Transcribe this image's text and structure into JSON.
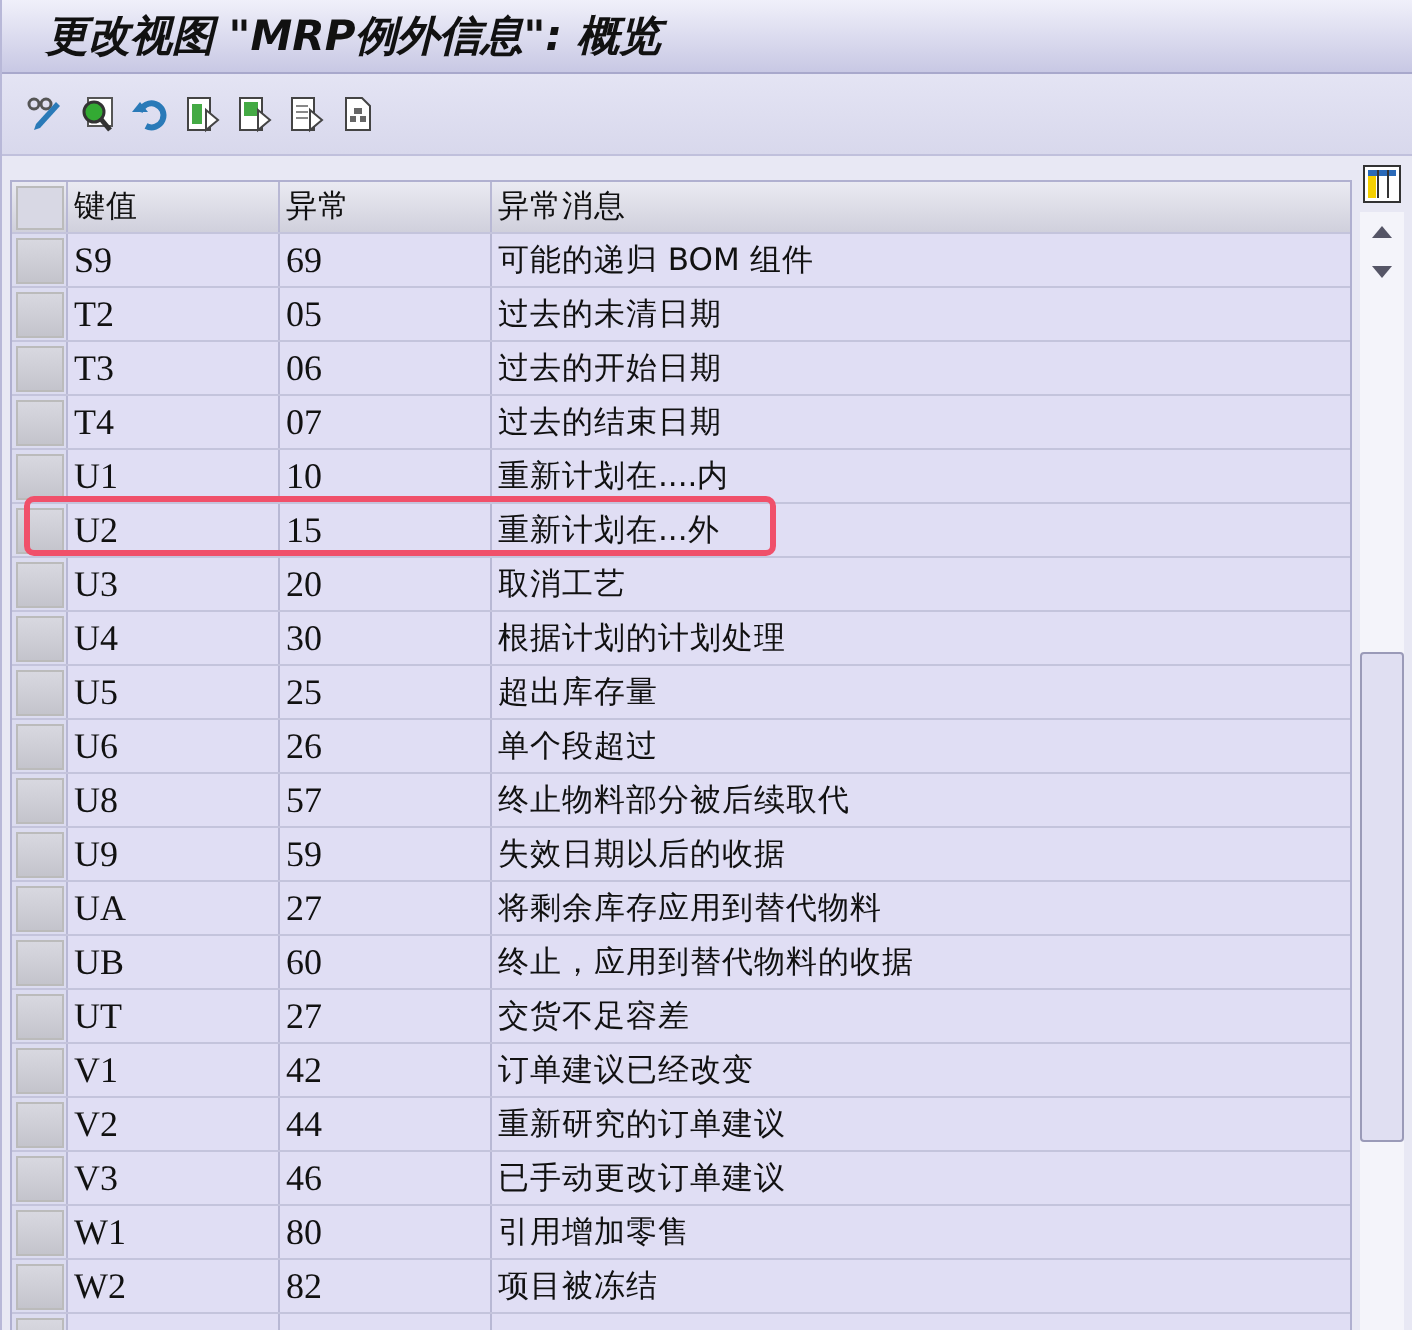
{
  "window": {
    "title": "更改视图 \"MRP例外信息\": 概览"
  },
  "table": {
    "columns": [
      "键值",
      "异常",
      "异常消息"
    ],
    "rows": [
      {
        "key": "S9",
        "exception": "69",
        "message": "可能的递归 BOM 组件",
        "highlighted": false
      },
      {
        "key": "T2",
        "exception": "05",
        "message": "过去的未清日期",
        "highlighted": false
      },
      {
        "key": "T3",
        "exception": "06",
        "message": "过去的开始日期",
        "highlighted": false
      },
      {
        "key": "T4",
        "exception": "07",
        "message": "过去的结束日期",
        "highlighted": false
      },
      {
        "key": "U1",
        "exception": "10",
        "message": "重新计划在....内",
        "highlighted": false
      },
      {
        "key": "U2",
        "exception": "15",
        "message": "重新计划在...外",
        "highlighted": true
      },
      {
        "key": "U3",
        "exception": "20",
        "message": "取消工艺",
        "highlighted": false
      },
      {
        "key": "U4",
        "exception": "30",
        "message": "根据计划的计划处理",
        "highlighted": false
      },
      {
        "key": "U5",
        "exception": "25",
        "message": "超出库存量",
        "highlighted": false
      },
      {
        "key": "U6",
        "exception": "26",
        "message": "单个段超过",
        "highlighted": false
      },
      {
        "key": "U8",
        "exception": "57",
        "message": "终止物料部分被后续取代",
        "highlighted": false
      },
      {
        "key": "U9",
        "exception": "59",
        "message": "失效日期以后的收据",
        "highlighted": false
      },
      {
        "key": "UA",
        "exception": "27",
        "message": "将剩余库存应用到替代物料",
        "highlighted": false
      },
      {
        "key": "UB",
        "exception": "60",
        "message": "终止，应用到替代物料的收据",
        "highlighted": false
      },
      {
        "key": "UT",
        "exception": "27",
        "message": "交货不足容差",
        "highlighted": false
      },
      {
        "key": "V1",
        "exception": "42",
        "message": "订单建议已经改变",
        "highlighted": false
      },
      {
        "key": "V2",
        "exception": "44",
        "message": "重新研究的订单建议",
        "highlighted": false
      },
      {
        "key": "V3",
        "exception": "46",
        "message": "已手动更改订单建议",
        "highlighted": false
      },
      {
        "key": "W1",
        "exception": "80",
        "message": "引用增加零售",
        "highlighted": false
      },
      {
        "key": "W2",
        "exception": "82",
        "message": "项目被冻结",
        "highlighted": false
      }
    ]
  }
}
